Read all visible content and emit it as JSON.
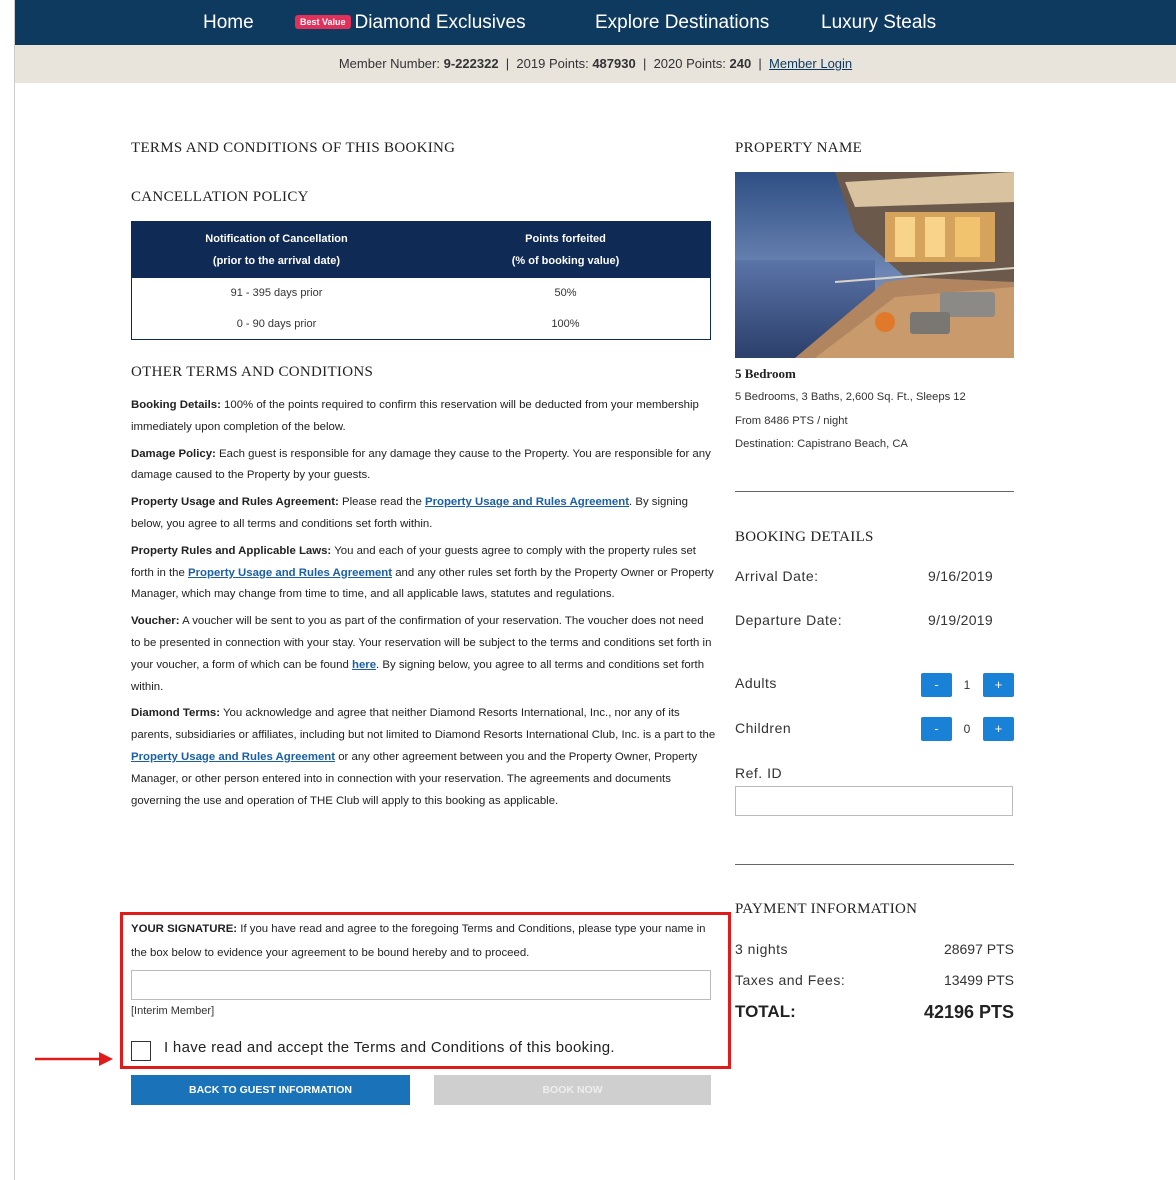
{
  "nav": {
    "home": "Home",
    "badge": "Best Value",
    "diamond_exclusives": "Diamond Exclusives",
    "explore_destinations": "Explore Destinations",
    "luxury_steals": "Luxury Steals"
  },
  "member_bar": {
    "member_number_label": "Member Number:",
    "member_number": "9-222322",
    "points_2019_label": "2019 Points:",
    "points_2019": "487930",
    "points_2020_label": "2020 Points:",
    "points_2020": "240",
    "login": "Member Login",
    "sep": "|"
  },
  "headings": {
    "terms": "TERMS AND CONDITIONS OF THIS BOOKING",
    "cancellation": "CANCELLATION POLICY",
    "other_terms": "OTHER TERMS AND CONDITIONS",
    "property_name": "PROPERTY NAME",
    "booking_details": "BOOKING DETAILS",
    "payment": "PAYMENT INFORMATION"
  },
  "cancel_table": {
    "col1_line1": "Notification of Cancellation",
    "col1_line2": "(prior to the arrival date)",
    "col2_line1": "Points forfeited",
    "col2_line2": "(% of booking value)",
    "rows": [
      {
        "period": "91 - 395 days prior",
        "pct": "50%"
      },
      {
        "period": "0 - 90 days prior",
        "pct": "100%"
      }
    ]
  },
  "terms": {
    "booking_title": "Booking Details:",
    "booking_text": " 100% of the points required to confirm this reservation will be deducted from your membership immediately upon completion of the below.",
    "damage_title": "Damage Policy:",
    "damage_text": " Each guest is responsible for any damage they cause to the Property. You are responsible for any damage caused to the Property by your guests.",
    "usage_title": "Property Usage and Rules Agreement:",
    "usage_text1": " Please read the ",
    "usage_link": "Property Usage and Rules Agreement",
    "usage_text2": ". By signing below, you agree to all terms and conditions set forth within.",
    "laws_title": "Property Rules and Applicable Laws:",
    "laws_text1": " You and each of your guests agree to comply with the property rules set forth in the ",
    "laws_link": "Property Usage and Rules Agreement",
    "laws_text2": " and any other rules set forth by the Property Owner or Property Manager, which may change from time to time, and all applicable laws, statutes and regulations.",
    "voucher_title": "Voucher:",
    "voucher_text1": " A voucher will be sent to you as part of the confirmation of your reservation. The voucher does not need to be presented in connection with your stay. Your reservation will be subject to the terms and conditions set forth in your voucher, a form of which can be found ",
    "voucher_link": "here",
    "voucher_text2": ". By signing below, you agree to all terms and conditions set forth within.",
    "diamond_title": "Diamond Terms:",
    "diamond_text1": " You acknowledge and agree that neither Diamond Resorts International, Inc., nor any of its parents, subsidiaries or affiliates, including but not limited to Diamond Resorts International Club, Inc. is a part to the ",
    "diamond_link": "Property Usage and Rules Agreement",
    "diamond_text2": " or any other agreement between you and the Property Owner, Property Manager, or other person entered into in connection with your reservation. The agreements and documents governing the use and operation of THE Club will apply to this booking as applicable."
  },
  "signature": {
    "title": "YOUR SIGNATURE:",
    "text": " If you have read and agree to the foregoing Terms and Conditions, please type your name in the box below to evidence your agreement to be bound hereby and to proceed.",
    "input_value": "",
    "member_type": "[Interim Member]",
    "accept_label": "I have read and accept the Terms and Conditions of this booking."
  },
  "buttons": {
    "back": "BACK TO GUEST INFORMATION",
    "book": "BOOK NOW"
  },
  "property": {
    "title": "5 Bedroom",
    "line1": "5 Bedrooms, 3 Baths, 2,600 Sq. Ft., Sleeps 12",
    "line2": "From 8486 PTS / night",
    "line3": "Destination: Capistrano Beach, CA"
  },
  "booking": {
    "arrival_label": "Arrival Date:",
    "arrival": "9/16/2019",
    "departure_label": "Departure Date:",
    "departure": "9/19/2019",
    "adults_label": "Adults",
    "adults": "1",
    "children_label": "Children",
    "children": "0",
    "ref_label": "Ref. ID",
    "ref_value": "",
    "minus": "-",
    "plus": "+"
  },
  "payment": {
    "nights_label": "3 nights",
    "nights_value": "28697 PTS",
    "taxes_label": "Taxes and Fees:",
    "taxes_value": "13499 PTS",
    "total_label": "TOTAL:",
    "total_value": "42196 PTS"
  },
  "colors": {
    "nav_bg": "#0f3a5f",
    "table_header": "#0f2a55",
    "highlight": "#e01b1b",
    "primary_button": "#1a72b8",
    "stepper": "#1a82d6"
  }
}
